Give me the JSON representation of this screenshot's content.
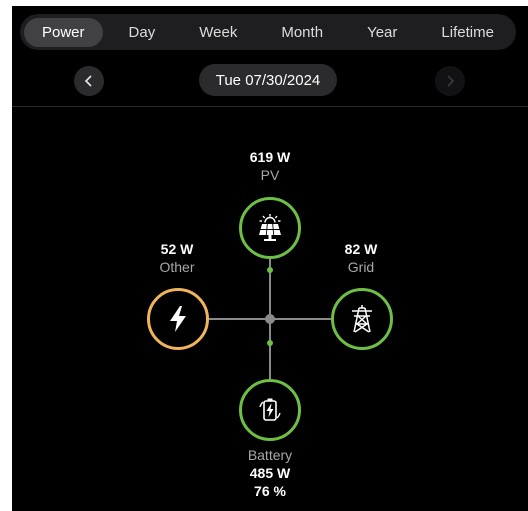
{
  "tabs": [
    {
      "label": "Power",
      "active": true
    },
    {
      "label": "Day",
      "active": false
    },
    {
      "label": "Week",
      "active": false
    },
    {
      "label": "Month",
      "active": false
    },
    {
      "label": "Year",
      "active": false
    },
    {
      "label": "Lifetime",
      "active": false
    }
  ],
  "date": "Tue 07/30/2024",
  "flow": {
    "pv": {
      "value": "619  W",
      "label": "PV",
      "icon": "solar-panel-icon"
    },
    "other": {
      "value": "52  W",
      "label": "Other",
      "icon": "lightning-icon"
    },
    "grid": {
      "value": "82  W",
      "label": "Grid",
      "icon": "transmission-tower-icon"
    },
    "battery": {
      "label": "Battery",
      "value": "485  W",
      "soc": "76 %",
      "icon": "battery-icon"
    }
  },
  "colors": {
    "active_ring": "#6dbf45",
    "other_ring": "#f0b45a",
    "background": "#000000"
  }
}
